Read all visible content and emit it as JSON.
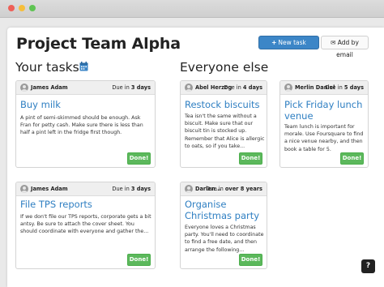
{
  "header": {
    "title": "Project Team Alpha",
    "new_task_label": "New task",
    "add_by_email_label": "Add by email"
  },
  "sections": {
    "yours": "Your tasks",
    "others": "Everyone else"
  },
  "cards": [
    {
      "owner": "James Adam",
      "due_prefix": "Due in ",
      "due_value": "3 days",
      "title": "Buy milk",
      "desc": "A pint of semi-skimmed should be enough. Ask Fran for petty cash. Make sure there is less than half a pint left in the fridge first though.",
      "done_label": "Done!"
    },
    {
      "owner": "James Adam",
      "due_prefix": "Due in ",
      "due_value": "3 days",
      "title": "File TPS reports",
      "desc": "If we don't file our TPS reports, corporate gets a bit antsy. Be sure to attach the cover sheet. You should coordinate with everyone and gather the...",
      "done_label": "Done!"
    },
    {
      "owner": "Abel Herzog",
      "due_prefix": "Due in ",
      "due_value": "4 days",
      "title": "Restock biscuits",
      "desc": "Tea isn't the same without a biscuit. Make sure that our biscuit tin is stocked up. Remember that Alice is allergic to oats, so if you take...",
      "done_label": "Done!"
    },
    {
      "owner": "Merlin Daniel",
      "due_prefix": "Due in ",
      "due_value": "5 days",
      "title": "Pick Friday lunch venue",
      "desc": "Team lunch is important for morale. Use Foursquare to find a nice venue nearby, and then book a table for 5.",
      "done_label": "Done!"
    },
    {
      "owner": "Darlen...",
      "due_prefix": "Due in ",
      "due_value": "over 8 years",
      "title": "Organise Christmas party",
      "desc": "Everyone loves a Christmas party. You'll need to coordinate to find a free date, and then arrange the following...",
      "done_label": "Done!"
    }
  ],
  "help_label": "?",
  "colors": {
    "primary": "#3c86c7",
    "success": "#5cb85c",
    "link": "#2f7fc2"
  },
  "icons": [
    "calendar-icon",
    "plus-icon",
    "envelope-icon",
    "question-icon",
    "avatar"
  ]
}
